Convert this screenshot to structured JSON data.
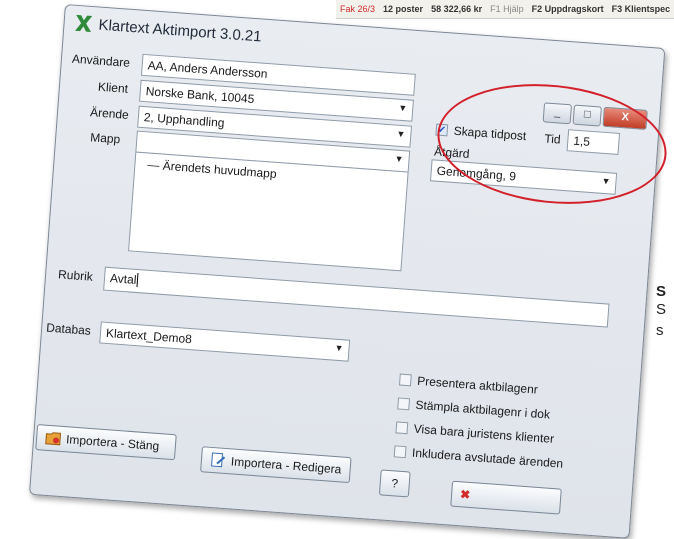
{
  "statusbar": {
    "items": [
      "Fak 26/3",
      "12 poster",
      "58 322,66 kr",
      "F1 Hjälp",
      "F2 Uppdragskort",
      "F3 Klientspec"
    ]
  },
  "sidetext": {
    "line1": "S",
    "line2": "S",
    "line3": "s"
  },
  "window": {
    "title": "Klartext Aktimport 3.0.21",
    "minimize_glyph": "_",
    "maximize_glyph": "□",
    "close_glyph": "X"
  },
  "form": {
    "anvandare": {
      "label": "Användare",
      "value": "AA, Anders Andersson"
    },
    "klient": {
      "label": "Klient",
      "value": "Norske Bank, 10045"
    },
    "arende": {
      "label": "Ärende",
      "value": "2, Upphandling"
    },
    "mapp": {
      "label": "Mapp",
      "item": "Ärendets huvudmapp"
    },
    "rubrik": {
      "label": "Rubrik",
      "value": "Avtal"
    },
    "databas": {
      "label": "Databas",
      "value": "Klartext_Demo8"
    }
  },
  "timepost": {
    "checkbox_label": "Skapa tidpost",
    "checked": true,
    "tid_label": "Tid",
    "tid_value": "1,5",
    "atgard_label": "Åtgärd",
    "atgard_value": "Genomgång, 9"
  },
  "options": [
    {
      "label": "Presentera aktbilagenr",
      "checked": false
    },
    {
      "label": "Stämpla aktbilagenr i dok",
      "checked": false
    },
    {
      "label": "Visa bara juristens klienter",
      "checked": false
    },
    {
      "label": "Inkludera avslutade ärenden",
      "checked": false
    }
  ],
  "buttons": {
    "importera_stang": "Importera - Stäng",
    "importera_redigera": "Importera - Redigera",
    "help": "?"
  },
  "colors": {
    "highlight": "#d3202a",
    "accent_check": "#1f4fbf"
  }
}
